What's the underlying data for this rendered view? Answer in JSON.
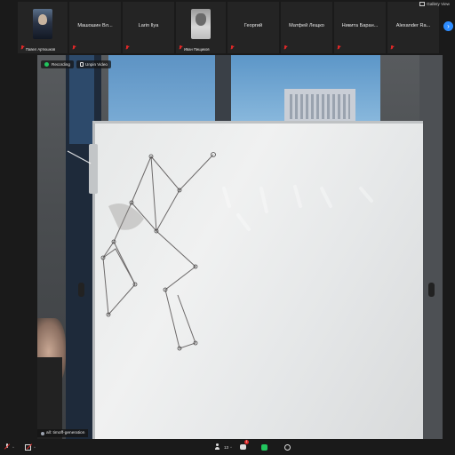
{
  "participants": [
    {
      "name": "",
      "sub_label": "Павел Артюшков",
      "muted": true,
      "has_avatar": true
    },
    {
      "name": "Машошин Вл...",
      "muted": true
    },
    {
      "name": "Larin Ilya",
      "muted": true
    },
    {
      "name": "",
      "sub_label": "Иван Пищиков",
      "muted": true,
      "has_avatar": true
    },
    {
      "name": "Георгий",
      "muted": true
    },
    {
      "name": "Матфей Лещко",
      "muted": true
    },
    {
      "name": "Никита Баран...",
      "muted": true
    },
    {
      "name": "Alexander Ra...",
      "muted": true
    }
  ],
  "header": {
    "view_label": "Gallery View",
    "next_icon": "chevron-right-icon"
  },
  "main_video": {
    "recording_label": "Recording",
    "recording_color": "#22c55e",
    "unpin_label": "Unpin Video",
    "speaker_name": "all: timoff-generation"
  },
  "toolbar": {
    "mute_caret": "^",
    "video_caret": "^",
    "participants_count": "13",
    "participants_caret": "^",
    "chat_badge": "1",
    "accent_share": "#22c55e",
    "muted_color": "#e02828"
  }
}
